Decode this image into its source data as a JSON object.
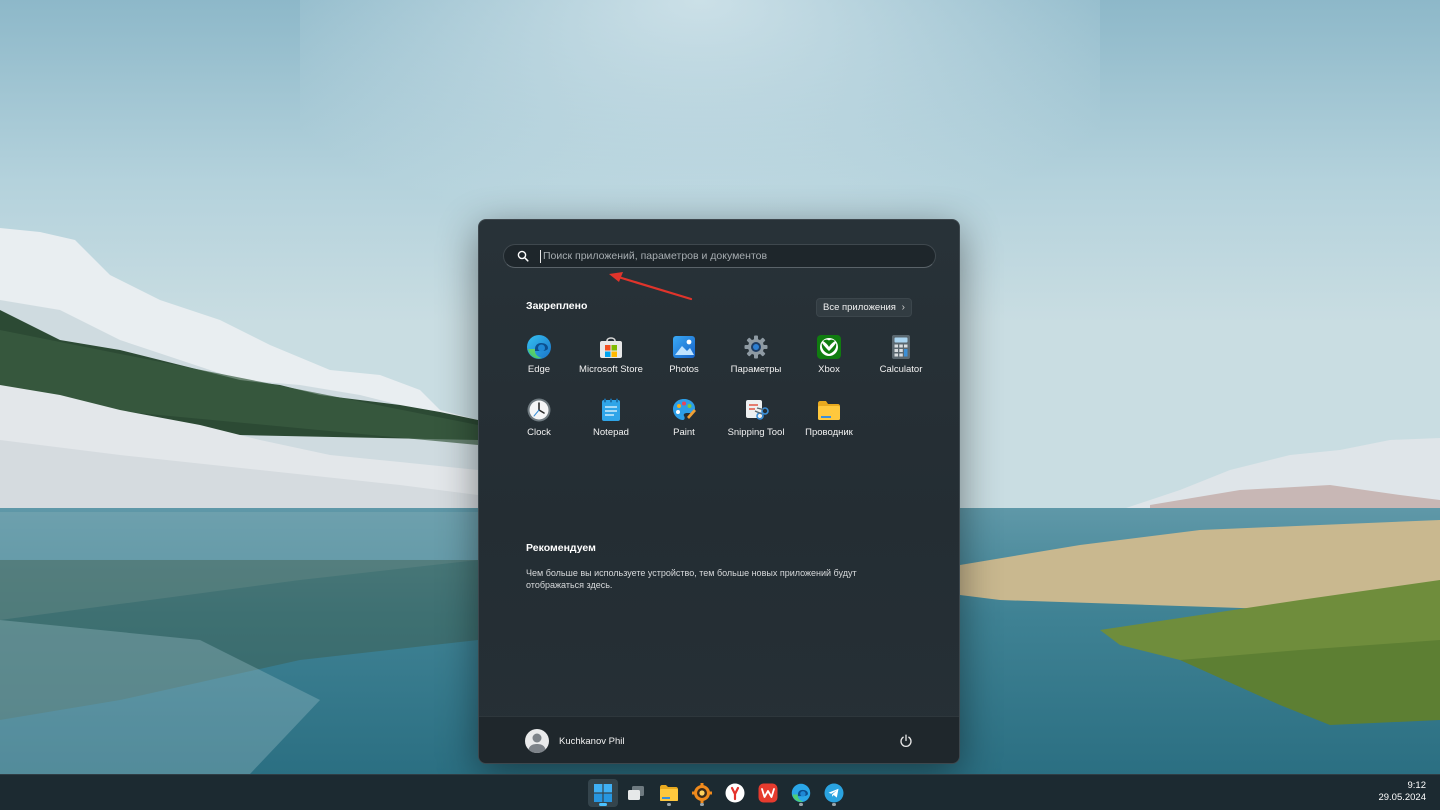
{
  "start_menu": {
    "search": {
      "placeholder": "Поиск приложений, параметров и документов",
      "value": ""
    },
    "pinned": {
      "title": "Закреплено",
      "all_apps_label": "Все приложения",
      "apps": [
        {
          "label": "Edge",
          "icon": "edge-icon"
        },
        {
          "label": "Microsoft Store",
          "icon": "store-icon"
        },
        {
          "label": "Photos",
          "icon": "photos-icon"
        },
        {
          "label": "Параметры",
          "icon": "settings-gear-icon"
        },
        {
          "label": "Xbox",
          "icon": "xbox-icon"
        },
        {
          "label": "Calculator",
          "icon": "calculator-icon"
        },
        {
          "label": "Clock",
          "icon": "clock-icon"
        },
        {
          "label": "Notepad",
          "icon": "notepad-icon"
        },
        {
          "label": "Paint",
          "icon": "paint-icon"
        },
        {
          "label": "Snipping Tool",
          "icon": "snipping-tool-icon"
        },
        {
          "label": "Проводник",
          "icon": "file-explorer-icon"
        }
      ]
    },
    "recommended": {
      "title": "Рекомендуем",
      "text": "Чем больше вы используете устройство, тем больше новых приложений будут отображаться здесь."
    },
    "user": {
      "name": "Kuchkanov Phil"
    }
  },
  "taskbar": {
    "items": [
      {
        "name": "start-button",
        "icon": "windows-logo-icon",
        "active": true
      },
      {
        "name": "task-view-button",
        "icon": "task-view-icon",
        "active": false
      },
      {
        "name": "file-explorer-button",
        "icon": "file-explorer-icon",
        "active": false
      },
      {
        "name": "xnview-button",
        "icon": "xnview-icon",
        "active": false
      },
      {
        "name": "yandex-browser-button",
        "icon": "yandex-icon",
        "active": false
      },
      {
        "name": "wps-office-button",
        "icon": "wps-icon",
        "active": false
      },
      {
        "name": "edge-button",
        "icon": "edge-icon",
        "active": false
      },
      {
        "name": "telegram-button",
        "icon": "telegram-icon",
        "active": false
      }
    ],
    "time": "9:12",
    "date": "29.05.2024"
  },
  "colors": {
    "accent": "#4cc2ff",
    "menu_background": "#242d33",
    "annotation_arrow": "#e0342b"
  }
}
